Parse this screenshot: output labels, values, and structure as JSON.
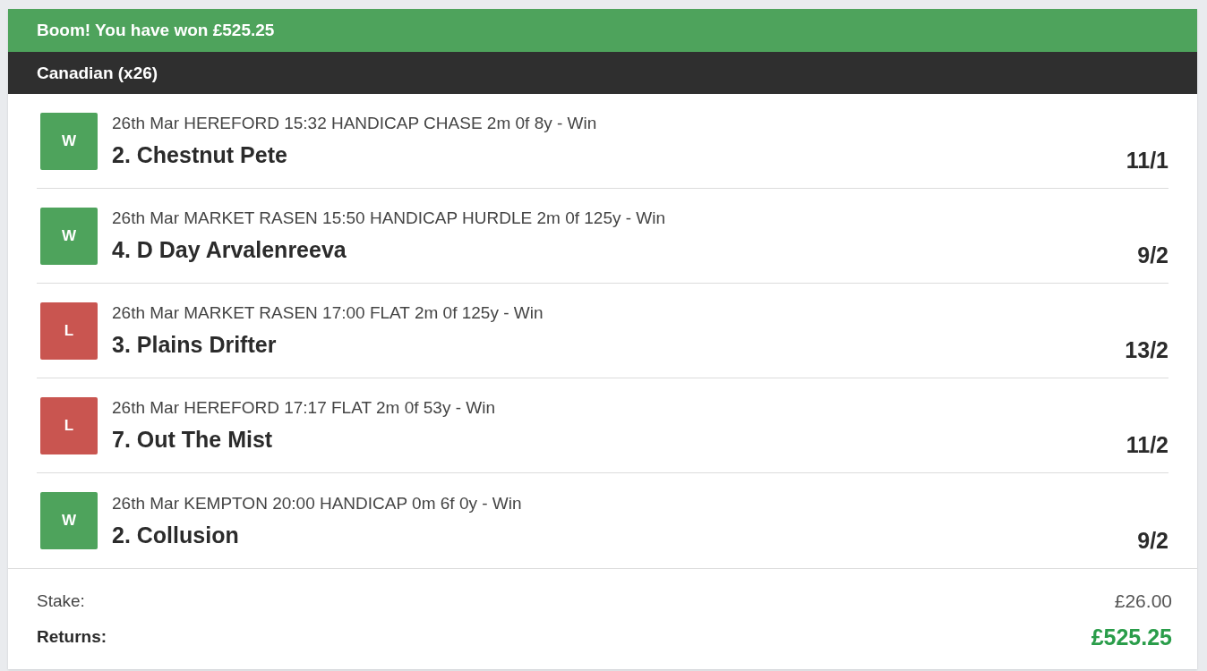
{
  "banner": {
    "text": "Boom! You have won £525.25"
  },
  "bet": {
    "title": "Canadian (x26)"
  },
  "selections": [
    {
      "kind": "win",
      "badge": "W",
      "event": "26th Mar HEREFORD 15:32 HANDICAP CHASE 2m 0f 8y - Win",
      "runner": "2. Chestnut Pete",
      "odds": "11/1"
    },
    {
      "kind": "win",
      "badge": "W",
      "event": "26th Mar MARKET RASEN 15:50 HANDICAP HURDLE 2m 0f 125y - Win",
      "runner": "4. D Day Arvalenreeva",
      "odds": "9/2"
    },
    {
      "kind": "lose",
      "badge": "L",
      "event": "26th Mar MARKET RASEN 17:00 FLAT 2m 0f 125y - Win",
      "runner": "3. Plains Drifter",
      "odds": "13/2"
    },
    {
      "kind": "lose",
      "badge": "L",
      "event": "26th Mar HEREFORD 17:17 FLAT 2m 0f 53y - Win",
      "runner": "7. Out The Mist",
      "odds": "11/2"
    },
    {
      "kind": "win",
      "badge": "W",
      "event": "26th Mar KEMPTON 20:00 HANDICAP 0m 6f 0y - Win",
      "runner": "2. Collusion",
      "odds": "9/2"
    }
  ],
  "summary": {
    "stake_label": "Stake:",
    "stake": "£26.00",
    "returns_label": "Returns:",
    "returns": "£525.25"
  }
}
